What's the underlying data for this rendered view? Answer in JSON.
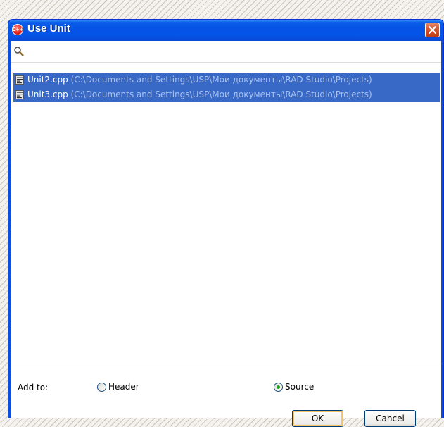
{
  "window": {
    "title": "Use Unit",
    "app_icon_text": "C++",
    "icons": {
      "app": "cpp-builder-icon",
      "close": "close-icon",
      "search": "search-icon",
      "file": "cpp-file-icon"
    }
  },
  "search": {
    "value": "",
    "placeholder": ""
  },
  "units": [
    {
      "name": "Unit2.cpp",
      "path": "(C:\\Documents and Settings\\USP\\Мои документы\\RAD Studio\\Projects)"
    },
    {
      "name": "Unit3.cpp",
      "path": "(C:\\Documents and Settings\\USP\\Мои документы\\RAD Studio\\Projects)"
    }
  ],
  "add_to": {
    "label": "Add to:",
    "options": [
      {
        "label": "Header",
        "checked": false
      },
      {
        "label": "Source",
        "checked": true
      }
    ]
  },
  "buttons": {
    "ok": "OK",
    "cancel": "Cancel"
  },
  "colors": {
    "titlebar": "#0653e6",
    "selection": "#3869c7",
    "selection_path": "#a9c2ef",
    "close": "#d8532c"
  }
}
